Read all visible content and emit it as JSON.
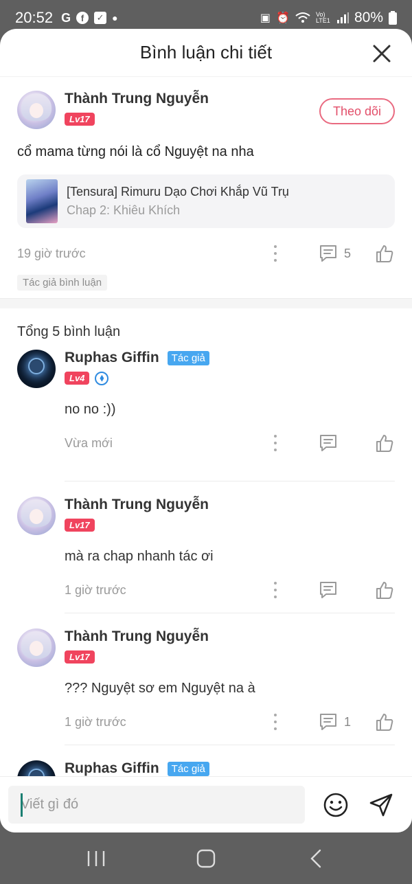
{
  "status_bar": {
    "time": "20:52",
    "battery": "80%",
    "left_icons": [
      "g-icon",
      "facebook-icon",
      "check-icon",
      "dot-icon"
    ],
    "right_icons": [
      "vpn-icon",
      "alarm-icon",
      "wifi-icon",
      "volte-icon",
      "signal-icon",
      "battery-icon"
    ],
    "volte_label": "Vo) LTE1"
  },
  "sheet": {
    "title": "Bình luận chi tiết"
  },
  "main_comment": {
    "user_name": "Thành Trung Nguyễn",
    "level": "Lv17",
    "follow_label": "Theo dõi",
    "text": "cổ mama từng nói là cổ Nguyệt na nha",
    "chapter_title": "[Tensura] Rimuru Dạo Chơi Khắp Vũ Trụ",
    "chapter_sub": "Chap 2: Khiêu Khích",
    "time": "19 giờ trước",
    "reply_count": "5",
    "author_comment_tag": "Tác giả bình luận"
  },
  "total_label": "Tổng 5 bình luận",
  "replies": [
    {
      "user_name": "Ruphas Giffin",
      "author_tag": "Tác giả",
      "level": "Lv4",
      "text": "no no :))",
      "time": "Vừa mới",
      "count": ""
    },
    {
      "user_name": "Thành Trung Nguyễn",
      "author_tag": "",
      "level": "Lv17",
      "text": "mà ra chap nhanh tác ơi",
      "time": "1 giờ trước",
      "count": ""
    },
    {
      "user_name": "Thành Trung Nguyễn",
      "author_tag": "",
      "level": "Lv17",
      "text": "??? Nguyệt sơ em Nguyệt na à",
      "time": "1 giờ trước",
      "count": "1"
    },
    {
      "user_name": "Ruphas Giffin",
      "author_tag": "Tác giả"
    }
  ],
  "composer": {
    "placeholder": "Viết gì đó"
  },
  "colors": {
    "accent_pink": "#e24e69",
    "level_badge": "#f0445e",
    "author_tag": "#47a7f0"
  }
}
